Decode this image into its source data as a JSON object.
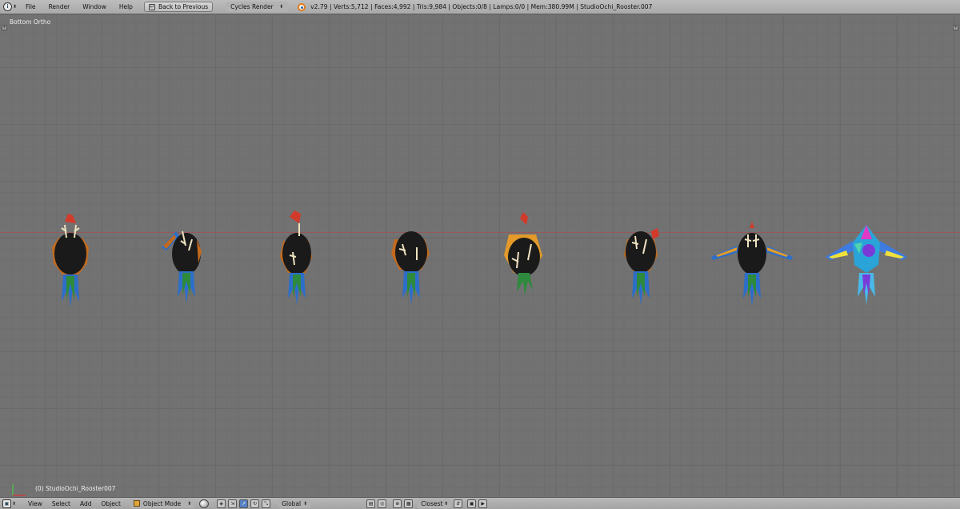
{
  "top_bar": {
    "menus": [
      "File",
      "Render",
      "Window",
      "Help"
    ],
    "back_button": "Back to Previous",
    "render_engine": "Cycles Render",
    "stats": "v2.79 | Verts:5,712 | Faces:4,992 | Tris:9,984 | Objects:0/8 | Lamps:0/0 | Mem:380.99M | StudioOchi_Rooster.007"
  },
  "viewport": {
    "view_name": "Bottom Ortho",
    "object_label": "(0) StudioOchi_Rooster007",
    "x_axis_color": "#9a5555",
    "grid_color": "#6a6a6a",
    "background_color": "#727272"
  },
  "bottom_bar": {
    "menus": [
      "View",
      "Select",
      "Add",
      "Object"
    ],
    "mode": "Object Mode",
    "orientation": "Global",
    "snap_target": "Closest"
  },
  "colors": {
    "header_bg": "#b4b4b4",
    "blender_orange": "#e37b1b",
    "active_button": "#5680c2"
  }
}
